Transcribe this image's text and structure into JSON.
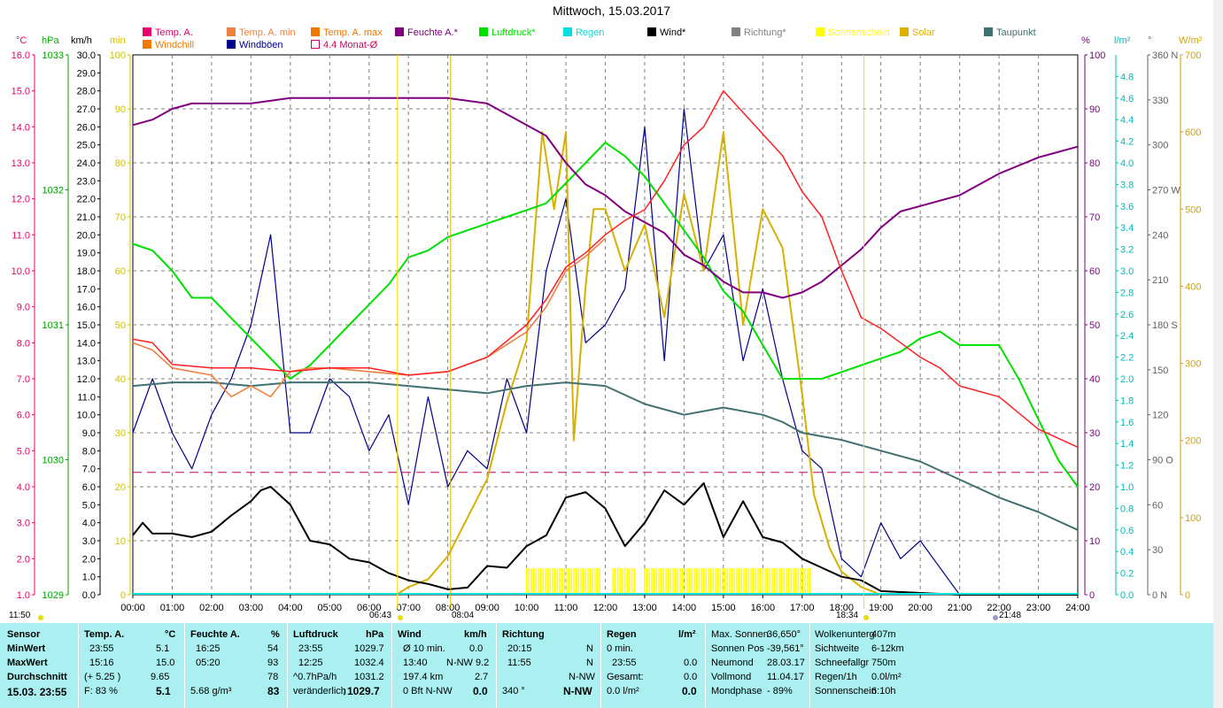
{
  "title": "Mittwoch, 15.03.2017",
  "legend": [
    {
      "label": "Temp. A.",
      "color": "#e8006c"
    },
    {
      "label": "Temp. A. min",
      "color": "#f08040"
    },
    {
      "label": "Temp. A. max",
      "color": "#f07800"
    },
    {
      "label": "Feuchte A.*",
      "color": "#800080"
    },
    {
      "label": "Luftdruck*",
      "color": "#00e000"
    },
    {
      "label": "Regen",
      "color": "#00e0e0"
    },
    {
      "label": "Wind*",
      "color": "#000000"
    },
    {
      "label": "Richtung*",
      "color": "#808080"
    },
    {
      "label": "Sonnenschein",
      "color": "#ffff00"
    },
    {
      "label": "Solar",
      "color": "#e0b000"
    },
    {
      "label": "Taupunkt",
      "color": "#407070"
    },
    {
      "label": "Windchill",
      "color": "#f07800"
    },
    {
      "label": "Windböen",
      "color": "#00008b"
    },
    {
      "label": "4.4 Monat-Ø",
      "color": "#cc0066"
    }
  ],
  "axis_heads": {
    "c": "°C",
    "hpa": "hPa",
    "kmh": "km/h",
    "min": "min",
    "pct": "%",
    "lm2": "l/m²",
    "deg": "°",
    "wm2": "W/m²"
  },
  "chart_data": {
    "type": "line",
    "x_ticks": [
      "00:00",
      "01:00",
      "02:00",
      "03:00",
      "04:00",
      "05:00",
      "06:00",
      "07:00",
      "08:00",
      "09:00",
      "10:00",
      "11:00",
      "12:00",
      "13:00",
      "14:00",
      "15:00",
      "16:00",
      "17:00",
      "18:00",
      "19:00",
      "20:00",
      "21:00",
      "22:00",
      "23:00",
      "24:00"
    ],
    "axes": {
      "temp_c": {
        "ticks": [
          "1.0",
          "2.0",
          "3.0",
          "4.0",
          "5.0",
          "6.0",
          "7.0",
          "8.0",
          "9.0",
          "10.0",
          "11.0",
          "12.0",
          "13.0",
          "14.0",
          "15.0",
          "16.0"
        ],
        "range": [
          1,
          16
        ]
      },
      "pressure_hpa": {
        "ticks": [
          "1029",
          "1030",
          "1031",
          "1032",
          "1033"
        ],
        "range": [
          1029,
          1033
        ]
      },
      "wind_kmh": {
        "ticks": [
          "0.0",
          "1.0",
          "2.0",
          "3.0",
          "4.0",
          "5.0",
          "6.0",
          "7.0",
          "8.0",
          "9.0",
          "10.0",
          "11.0",
          "12.0",
          "13.0",
          "14.0",
          "15.0",
          "16.0",
          "17.0",
          "18.0",
          "19.0",
          "20.0",
          "21.0",
          "22.0",
          "23.0",
          "24.0",
          "25.0",
          "26.0",
          "27.0",
          "28.0",
          "29.0",
          "30.0"
        ],
        "range": [
          0,
          30
        ]
      },
      "sun_min": {
        "ticks": [
          "0",
          "10",
          "20",
          "30",
          "40",
          "50",
          "60",
          "70",
          "80",
          "90",
          "100"
        ],
        "range": [
          0,
          100
        ]
      },
      "humidity_pct": {
        "ticks": [
          "0",
          "10",
          "20",
          "30",
          "40",
          "50",
          "60",
          "70",
          "80",
          "90",
          "100"
        ],
        "range": [
          0,
          100
        ]
      },
      "rain_lm2": {
        "ticks": [
          "0.0",
          "0.2",
          "0.4",
          "0.6",
          "0.8",
          "1.0",
          "1.2",
          "1.4",
          "1.6",
          "1.8",
          "2.0",
          "2.2",
          "2.4",
          "2.6",
          "2.8",
          "3.0",
          "3.2",
          "3.4",
          "3.6",
          "3.8",
          "4.0",
          "4.2",
          "4.4",
          "4.6",
          "4.8"
        ],
        "range": [
          0,
          5
        ]
      },
      "direction_deg": {
        "ticks": [
          "0 N",
          "30",
          "60",
          "90 O",
          "120",
          "150",
          "180 S",
          "210",
          "240",
          "270 W",
          "300",
          "330",
          "360 N"
        ],
        "range": [
          0,
          360
        ]
      },
      "solar_wm2": {
        "ticks": [
          "0",
          "100",
          "200",
          "300",
          "400",
          "500",
          "600",
          "700"
        ],
        "range": [
          0,
          700
        ]
      }
    },
    "series": [
      {
        "name": "Temp. A.",
        "unit": "°C",
        "x": [
          0,
          0.5,
          1,
          2,
          3,
          4,
          5,
          6,
          7,
          8,
          9,
          10,
          10.5,
          11,
          11.5,
          12,
          12.5,
          13,
          13.5,
          14,
          14.5,
          15,
          15.5,
          16,
          16.5,
          17,
          17.5,
          18,
          18.5,
          19,
          19.5,
          20,
          20.5,
          21,
          22,
          23,
          24
        ],
        "y": [
          8.1,
          8.0,
          7.4,
          7.3,
          7.3,
          7.2,
          7.3,
          7.3,
          7.1,
          7.2,
          7.6,
          8.5,
          9.2,
          10.1,
          10.5,
          11.0,
          11.4,
          11.7,
          12.5,
          13.5,
          14.0,
          15.0,
          14.4,
          13.8,
          13.2,
          12.2,
          11.5,
          10.0,
          8.7,
          8.4,
          8.0,
          7.6,
          7.3,
          6.8,
          6.5,
          5.6,
          5.1
        ]
      },
      {
        "name": "Temp. A. min",
        "unit": "°C",
        "x": [
          0,
          0.5,
          1,
          2,
          2.5,
          3,
          3.5,
          4,
          4.5,
          5,
          6,
          7,
          8,
          9,
          10,
          10.5,
          11,
          11.5,
          12
        ],
        "y": [
          8.0,
          7.8,
          7.3,
          7.1,
          6.5,
          6.8,
          6.5,
          7.2,
          7.3,
          7.3,
          7.2,
          7.1,
          7.2,
          7.6,
          8.3,
          9.0,
          10.0,
          10.4,
          10.9
        ]
      },
      {
        "name": "Feuchte A.",
        "unit": "%",
        "x": [
          0,
          0.5,
          1,
          1.5,
          2,
          3,
          4,
          5,
          6,
          7,
          8,
          9,
          10,
          10.5,
          11,
          11.5,
          12,
          12.5,
          13,
          13.5,
          14,
          14.5,
          15,
          15.5,
          16,
          16.5,
          17,
          17.5,
          18,
          18.5,
          19,
          19.5,
          20,
          21,
          22,
          23,
          24
        ],
        "y": [
          87,
          88,
          90,
          91,
          91,
          91,
          92,
          92,
          92,
          92,
          92,
          91,
          87,
          85,
          80,
          76,
          74,
          71,
          69,
          67,
          63,
          61,
          58,
          56,
          56,
          55,
          56,
          58,
          61,
          64,
          68,
          71,
          72,
          74,
          78,
          81,
          83
        ]
      },
      {
        "name": "Luftdruck",
        "unit": "hPa",
        "x": [
          0,
          0.5,
          1,
          1.5,
          2,
          2.5,
          3,
          3.5,
          4,
          4.5,
          5,
          5.5,
          6,
          6.5,
          7,
          7.5,
          8,
          8.5,
          9,
          9.5,
          10,
          10.5,
          11,
          11.5,
          12,
          12.5,
          13,
          13.5,
          14,
          14.5,
          15,
          15.5,
          16,
          16.5,
          17,
          17.5,
          18,
          18.5,
          19,
          19.5,
          20,
          20.5,
          21,
          21.5,
          22,
          22.5,
          23,
          23.5,
          24
        ],
        "y": [
          1031.6,
          1031.55,
          1031.4,
          1031.2,
          1031.2,
          1031.05,
          1030.9,
          1030.75,
          1030.6,
          1030.7,
          1030.85,
          1031.0,
          1031.15,
          1031.3,
          1031.5,
          1031.55,
          1031.65,
          1031.7,
          1031.75,
          1031.8,
          1031.85,
          1031.9,
          1032.05,
          1032.2,
          1032.35,
          1032.25,
          1032.1,
          1031.9,
          1031.7,
          1031.5,
          1031.25,
          1031.1,
          1030.85,
          1030.6,
          1030.6,
          1030.6,
          1030.65,
          1030.7,
          1030.75,
          1030.8,
          1030.9,
          1030.95,
          1030.85,
          1030.85,
          1030.85,
          1030.6,
          1030.3,
          1030.0,
          1029.8
        ]
      },
      {
        "name": "Taupunkt",
        "unit": "°C",
        "x": [
          0,
          1,
          2,
          3,
          4,
          5,
          6,
          7,
          8,
          9,
          10,
          11,
          12,
          13,
          14,
          15,
          16,
          16.5,
          17,
          18,
          19,
          20,
          21,
          22,
          23,
          24
        ],
        "y": [
          6.8,
          6.9,
          6.9,
          6.8,
          6.9,
          6.9,
          6.9,
          6.8,
          6.7,
          6.6,
          6.8,
          6.9,
          6.8,
          6.3,
          6.0,
          6.2,
          6.0,
          5.8,
          5.5,
          5.3,
          5.0,
          4.7,
          4.2,
          3.7,
          3.3,
          2.8
        ]
      },
      {
        "name": "Wind",
        "unit": "km/h",
        "x": [
          0,
          0.25,
          0.5,
          1,
          1.5,
          2,
          2.5,
          3,
          3.25,
          3.5,
          4,
          4.5,
          5,
          5.5,
          6,
          6.5,
          7,
          7.5,
          8,
          8.5,
          9,
          9.5,
          10,
          10.5,
          11,
          11.5,
          12,
          12.5,
          13,
          13.5,
          14,
          14.5,
          15,
          15.5,
          16,
          16.5,
          17,
          17.5,
          18,
          18.5,
          19,
          20,
          21,
          22,
          23,
          24
        ],
        "y": [
          3.3,
          4.0,
          3.4,
          3.4,
          3.2,
          3.5,
          4.4,
          5.2,
          5.8,
          6.0,
          5.0,
          3.0,
          2.8,
          2.0,
          1.8,
          1.2,
          0.8,
          0.6,
          0.3,
          0.4,
          1.6,
          1.5,
          2.7,
          3.3,
          5.4,
          5.7,
          4.8,
          2.7,
          4.0,
          5.8,
          5.0,
          6.2,
          3.2,
          5.2,
          3.2,
          2.9,
          2.0,
          1.5,
          1.0,
          0.8,
          0.2,
          0.1,
          0.0,
          0.0,
          0.0,
          0.0
        ]
      },
      {
        "name": "Solar",
        "unit": "W/m²",
        "x": [
          6.7,
          7,
          7.5,
          8,
          8.5,
          9,
          9.5,
          10,
          10.4,
          10.7,
          11,
          11.2,
          11.5,
          11.7,
          12,
          12.5,
          13,
          13.5,
          14,
          14.5,
          15,
          15.5,
          16,
          16.5,
          17,
          17.3,
          17.7,
          18,
          18.5,
          19
        ],
        "y": [
          0,
          10,
          20,
          50,
          100,
          150,
          250,
          330,
          600,
          500,
          600,
          200,
          400,
          500,
          500,
          420,
          480,
          360,
          520,
          420,
          600,
          350,
          500,
          450,
          260,
          130,
          60,
          30,
          10,
          0
        ]
      },
      {
        "name": "Windböen",
        "unit": "km/h",
        "x": [
          0,
          0.5,
          1,
          1.5,
          2,
          2.5,
          3,
          3.5,
          4,
          4.5,
          5,
          5.5,
          6,
          6.5,
          7,
          7.5,
          8,
          8.5,
          9,
          9.5,
          10,
          10.5,
          11,
          11.5,
          12,
          12.5,
          13,
          13.5,
          14,
          14.5,
          15,
          15.5,
          16,
          16.5,
          17,
          17.5,
          18,
          18.5,
          19,
          19.5,
          20,
          21,
          22,
          23,
          24
        ],
        "y": [
          9.0,
          12.0,
          9.0,
          7.0,
          10.0,
          12.0,
          15.0,
          20.0,
          9.0,
          9.0,
          12.0,
          11.0,
          8.0,
          10.0,
          5.0,
          11.0,
          6.0,
          8.0,
          7.0,
          12.0,
          9.0,
          18.0,
          22.0,
          14.0,
          15.0,
          17.0,
          26.0,
          13.0,
          27.0,
          18.0,
          20.0,
          13.0,
          17.0,
          12.0,
          8.0,
          7.0,
          2.0,
          1.0,
          4.0,
          2.0,
          3.0,
          0.0,
          0.0,
          0.0,
          0.0
        ]
      },
      {
        "name": "4.4 Monat-Ø",
        "unit": "°C",
        "x": [
          0,
          24
        ],
        "y": [
          4.4,
          4.4
        ]
      }
    ],
    "sunshine_ranges": [
      [
        10.0,
        11.9
      ],
      [
        12.2,
        12.8
      ],
      [
        13.0,
        17.2
      ]
    ],
    "markers": {
      "sunrise": "06:43",
      "sunset": "18:34",
      "moon_left": "11:50",
      "moon_right": "21:48",
      "m1": "08:04"
    }
  },
  "stats": {
    "date": "15.03. 23:55",
    "sensor": {
      "h": "Sensor",
      "min": "MinWert",
      "max": "MaxWert",
      "avg": "Durchschnitt"
    },
    "temp": {
      "h": "Temp. A.",
      "u": "°C",
      "min_t": "23:55",
      "min_v": "5.1",
      "max_t": "15:16",
      "max_v": "15.0",
      "avg_a": "(+ 5.25 )",
      "avg_v": "9.65",
      "f": "F: 83 %",
      "cur": "5.1"
    },
    "feuchte": {
      "h": "Feuchte A.",
      "u": "%",
      "min_t": "16:25",
      "min_v": "54",
      "max_t": "05:20",
      "max_v": "93",
      "avg_v": "78",
      "abs": "5.68 g/m³",
      "cur": "83"
    },
    "druck": {
      "h": "Luftdruck",
      "u": "hPa",
      "min_t": "23:55",
      "min_v": "1029.7",
      "max_t": "12:25",
      "max_v": "1032.4",
      "avg_a": "^0.7hPa/h",
      "avg_v": "1031.2",
      "trend": "veränderlich",
      "cur": "↓1029.7"
    },
    "wind": {
      "h": "Wind",
      "u": "km/h",
      "r1a": "Ø 10 min.",
      "r1b": "0.0",
      "r2a": "13:40",
      "r2b": "N-NW 9.2",
      "r3a": "197.4 km",
      "r3b": "2.7",
      "r4a": "0 Bft N-NW",
      "r4b": "0.0"
    },
    "richtung": {
      "h": "Richtung",
      "r1a": "20:15",
      "r1b": "N",
      "r2a": "11:55",
      "r2b": "N",
      "r3b": "N-NW",
      "r4a": "340 °",
      "r4b": "N-NW"
    },
    "regen": {
      "h": "Regen",
      "u": "l/m²",
      "r1a": "0 min.",
      "r2a": "23:55",
      "r2b": "0.0",
      "r3a": "Gesamt:",
      "r3b": "0.0",
      "r4a": "0.0 l/m²",
      "r4b": "0.0"
    },
    "astro": [
      [
        "Max. Sonnen",
        "36,650°"
      ],
      [
        "Sonnen Pos",
        "-39,561°"
      ],
      [
        "Neumond",
        "28.03.17"
      ],
      [
        "Vollmond",
        "11.04.17"
      ],
      [
        "Mondphase",
        "- 89%"
      ]
    ],
    "weather": [
      [
        "Wolkenunterg",
        "407m"
      ],
      [
        "Sichtweite",
        "6-12km"
      ],
      [
        "Schneefallgr",
        "750m"
      ],
      [
        "Regen/1h",
        "0.0l/m²"
      ],
      [
        "Sonnenschein",
        "6:10h"
      ]
    ]
  }
}
